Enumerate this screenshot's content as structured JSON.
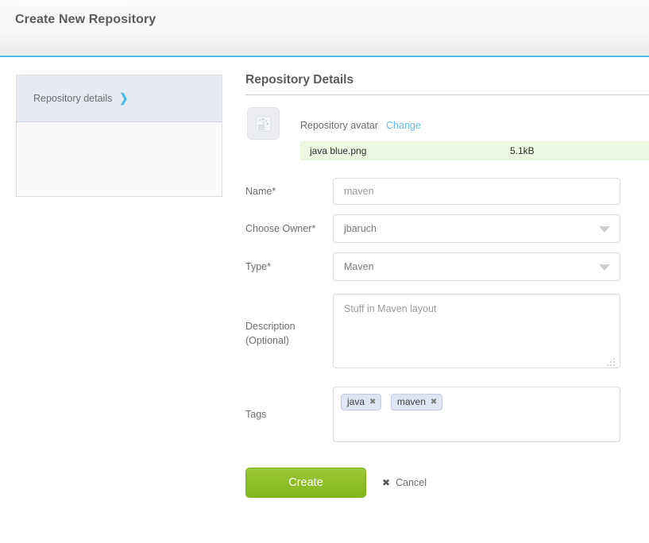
{
  "header": {
    "title": "Create New Repository"
  },
  "wizard": {
    "steps": [
      {
        "label": "Repository details",
        "arrow": "chevron-right-icon",
        "active": true
      }
    ]
  },
  "main": {
    "section_title": "Repository Details",
    "avatar": {
      "icon": "image-placeholder-icon",
      "label": "Repository avatar",
      "change_link": "Change",
      "upload": {
        "filename": "java blue.png",
        "filesize": "5.1kB",
        "row_color": "#edf8e0"
      }
    },
    "fields": {
      "name": {
        "label": "Name*",
        "value": "maven",
        "placeholder": "maven"
      },
      "owner": {
        "label": "Choose Owner*",
        "value": "jbaruch",
        "arrow_icon": "chevron-down-icon"
      },
      "type": {
        "label": "Type*",
        "value": "Maven",
        "arrow_icon": "chevron-down-icon"
      },
      "description": {
        "label": "Description (Optional)",
        "label_line1": "Description",
        "label_line2": "(Optional)",
        "value": "Stuff in Maven layout",
        "resize_grip": "resize-grip-icon"
      },
      "tags": {
        "label": "Tags",
        "chips": [
          {
            "label": "java",
            "remove": "✖"
          },
          {
            "label": "maven",
            "remove": "✖"
          }
        ]
      }
    },
    "actions": {
      "create_label": "Create",
      "cancel_label": "Cancel",
      "cancel_icon": "✖"
    }
  },
  "colors": {
    "accent_blue": "#4cbce8",
    "link_blue": "#63bdec",
    "create_green": "#8dbf27",
    "success_row": "#edf8e0",
    "chip_blue": "#dfe5f3",
    "step_active": "#e6eaf3"
  }
}
